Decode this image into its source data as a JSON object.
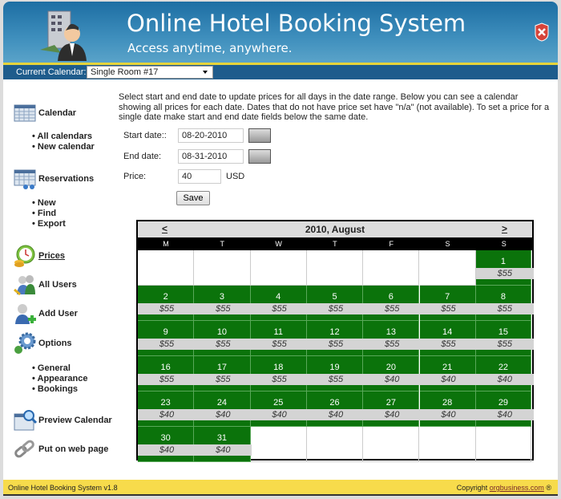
{
  "header": {
    "title": "Online Hotel Booking System",
    "subtitle": "Access anytime, anywhere.",
    "logo_icon": "hotel-manager-icon",
    "close_icon": "close-shield-icon"
  },
  "navbar": {
    "label": "Current Calendar:",
    "selected": "Single Room #17"
  },
  "sidebar": {
    "calendar": {
      "label": "Calendar",
      "items": [
        "All calendars",
        "New calendar"
      ]
    },
    "reservations": {
      "label": "Reservations",
      "items": [
        "New",
        "Find",
        "Export"
      ]
    },
    "prices": {
      "label": "Prices"
    },
    "all_users": {
      "label": "All Users"
    },
    "add_user": {
      "label": "Add User"
    },
    "options": {
      "label": "Options",
      "items": [
        "General",
        "Appearance",
        "Bookings"
      ]
    },
    "preview": {
      "label": "Preview Calendar"
    },
    "web": {
      "label": "Put on web page"
    }
  },
  "form": {
    "intro": "Select start and end date to update prices for all days in the date range. Below you can see a calendar showing all prices for each date. Dates that do not have price set have \"n/a\" (not available). To set a price for a single date make start and end date fields below the same date.",
    "start_label": "Start date::",
    "start_value": "08-20-2010",
    "end_label": "End date:",
    "end_value": "08-31-2010",
    "price_label": "Price:",
    "price_value": "40",
    "currency": "USD",
    "save": "Save"
  },
  "calendar": {
    "title": "2010, August",
    "prev": "<",
    "next": ">",
    "weekdays": [
      "M",
      "T",
      "W",
      "T",
      "F",
      "S",
      "S"
    ],
    "first_weekday_index": 6,
    "days": [
      {
        "d": "1",
        "p": "$55"
      },
      {
        "d": "2",
        "p": "$55"
      },
      {
        "d": "3",
        "p": "$55"
      },
      {
        "d": "4",
        "p": "$55"
      },
      {
        "d": "5",
        "p": "$55"
      },
      {
        "d": "6",
        "p": "$55"
      },
      {
        "d": "7",
        "p": "$55"
      },
      {
        "d": "8",
        "p": "$55"
      },
      {
        "d": "9",
        "p": "$55"
      },
      {
        "d": "10",
        "p": "$55"
      },
      {
        "d": "11",
        "p": "$55"
      },
      {
        "d": "12",
        "p": "$55"
      },
      {
        "d": "13",
        "p": "$55"
      },
      {
        "d": "14",
        "p": "$55"
      },
      {
        "d": "15",
        "p": "$55"
      },
      {
        "d": "16",
        "p": "$55"
      },
      {
        "d": "17",
        "p": "$55"
      },
      {
        "d": "18",
        "p": "$55"
      },
      {
        "d": "19",
        "p": "$55"
      },
      {
        "d": "20",
        "p": "$40"
      },
      {
        "d": "21",
        "p": "$40"
      },
      {
        "d": "22",
        "p": "$40"
      },
      {
        "d": "23",
        "p": "$40"
      },
      {
        "d": "24",
        "p": "$40"
      },
      {
        "d": "25",
        "p": "$40"
      },
      {
        "d": "26",
        "p": "$40"
      },
      {
        "d": "27",
        "p": "$40"
      },
      {
        "d": "28",
        "p": "$40"
      },
      {
        "d": "29",
        "p": "$40"
      },
      {
        "d": "30",
        "p": "$40"
      },
      {
        "d": "31",
        "p": "$40"
      }
    ],
    "available_color": "#0b730b"
  },
  "footer": {
    "left": "Online Hotel Booking System v1.8",
    "copyright": "Copyright",
    "link": "orgbusiness.com",
    "symbol": "®"
  }
}
